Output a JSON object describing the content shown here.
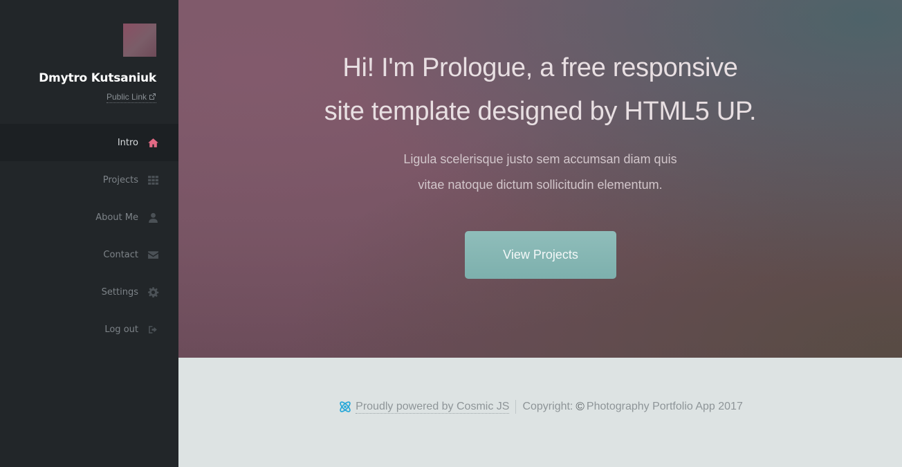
{
  "sidebar": {
    "name": "Dmytro Kutsaniuk",
    "public_link": "Public Link",
    "nav": [
      {
        "label": "Intro",
        "icon": "home-icon",
        "active": true
      },
      {
        "label": "Projects",
        "icon": "grid-icon",
        "active": false
      },
      {
        "label": "About Me",
        "icon": "user-icon",
        "active": false
      },
      {
        "label": "Contact",
        "icon": "envelope-icon",
        "active": false
      },
      {
        "label": "Settings",
        "icon": "gear-icon",
        "active": false
      },
      {
        "label": "Log out",
        "icon": "sign-out-icon",
        "active": false
      }
    ]
  },
  "hero": {
    "title_line1": "Hi! I'm Prologue, a free responsive",
    "title_line2": "site template designed by HTML5 UP.",
    "sub_line1": "Ligula scelerisque justo sem accumsan diam quis",
    "sub_line2": "vitae natoque dictum sollicitudin elementum.",
    "button": "View Projects"
  },
  "footer": {
    "powered": "Proudly powered by Cosmic JS",
    "copyright_label": "Copyright:",
    "copyright_symbol": "©",
    "copyright_text": "Photography Portfolio App 2017"
  },
  "colors": {
    "sidebar_bg": "#222629",
    "active_icon": "#e36a85",
    "button": "#87b7b4",
    "footer_bg": "#dde3e3"
  }
}
